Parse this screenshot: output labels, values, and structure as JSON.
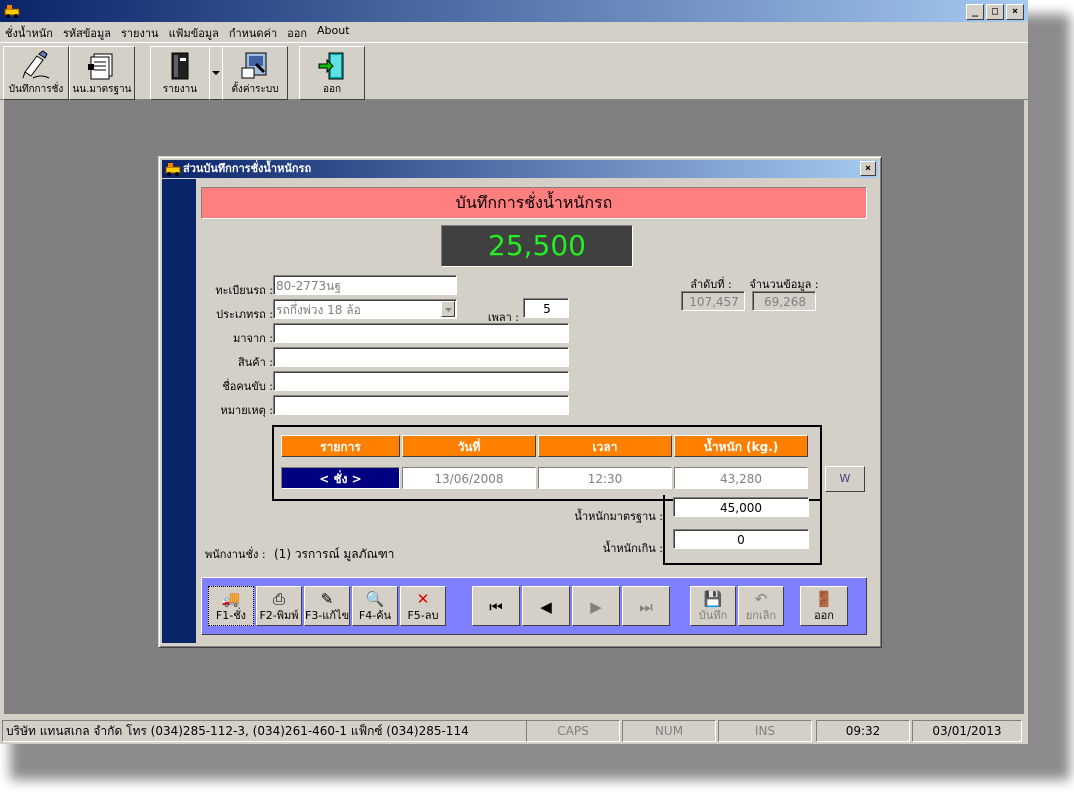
{
  "app": {
    "window_buttons": [
      "_",
      "□",
      "×"
    ]
  },
  "menu": [
    "ชั่งน้ำหนัก",
    "รหัสข้อมูล",
    "รายงาน",
    "แฟ้มข้อมูล",
    "กำหนดค่า",
    "ออก",
    "About"
  ],
  "toolbar": {
    "record": "บันทึกการชั่ง",
    "standard": "นน.มาตรฐาน",
    "report": "รายงาน",
    "settings": "ตั้งค่าระบบ",
    "exit": "ออก"
  },
  "child": {
    "title": "ส่วนบันทึกการชั่งน้ำหนักรถ",
    "close": "×",
    "banner": "บันทึกการชั่งน้ำหนักรถ",
    "display_weight": "25,500",
    "labels": {
      "plate": "ทะเบียนรถ :",
      "type": "ประเภทรถ :",
      "from": "มาจาก :",
      "product": "สินค้า :",
      "driver": "ชื่อคนขับ :",
      "note": "หมายเหตุ :",
      "shift": "เพลา :",
      "seq": "ลำดับที่ :",
      "count": "จำนวนข้อมูล :",
      "std_weight": "น้ำหนักมาตรฐาน :",
      "over_weight": "น้ำหนักเกิน :",
      "operator": "พนักงานชั่ง :"
    },
    "values": {
      "plate": "80-2773นฐ",
      "type": "รถกึ่งพ่วง 18 ล้อ",
      "from": "",
      "product": "",
      "driver": "",
      "note": "",
      "shift": "5",
      "seq": "107,457",
      "count": "69,268",
      "std_weight": "45,000",
      "over_weight": "0",
      "operator": "(1)  วรการณ์ มูลภัณฑา"
    },
    "grid": {
      "headers": [
        "รายการ",
        "วันที่",
        "เวลา",
        "น้ำหนัก (kg.)"
      ],
      "row": [
        "< ชั่ง >",
        "13/06/2008",
        "12:30",
        "43,280"
      ]
    },
    "w_button": "W",
    "nav": {
      "f1": "F1-ชั่ง",
      "f2": "F2-พิมพ์",
      "f3": "F3-แก้ไข",
      "f4": "F4-ค้น",
      "f5": "F5-ลบ",
      "save": "บันทึก",
      "cancel": "ยกเลิก",
      "exit": "ออก"
    }
  },
  "status": {
    "company": "บริษัท แทนสเกล จำกัด  โทร (034)285-112-3, (034)261-460-1  แฟ็กซ์ (034)285-114",
    "caps": "CAPS",
    "num": "NUM",
    "ins": "INS",
    "time": "09:32",
    "date": "03/01/2013"
  },
  "colors": {
    "banner": "#ff7f7f",
    "header": "#ff8000",
    "nav": "#8080ff",
    "selected": "#000080",
    "display_text": "#22ee22"
  }
}
